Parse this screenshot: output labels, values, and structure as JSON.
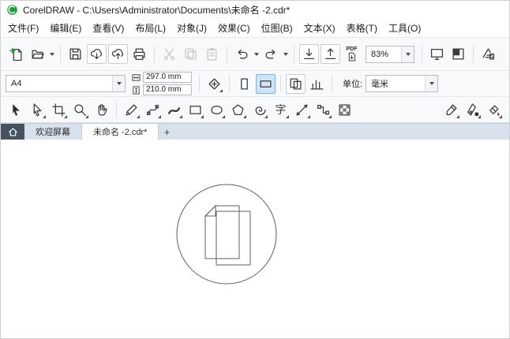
{
  "window": {
    "title": "CorelDRAW - C:\\Users\\Administrator\\Documents\\未命名 -2.cdr*"
  },
  "menu_bar": {
    "items": [
      "文件(F)",
      "编辑(E)",
      "查看(V)",
      "布局(L)",
      "对象(J)",
      "效果(C)",
      "位图(B)",
      "文本(X)",
      "表格(T)",
      "工具(O)"
    ]
  },
  "standard_toolbar": {
    "zoom_value": "83%",
    "pdf_label": "PDF",
    "icons": [
      "new-document",
      "open-document",
      "save",
      "open-from-cloud",
      "save-to-cloud",
      "print",
      "cut",
      "copy",
      "paste",
      "undo",
      "redo",
      "import",
      "export",
      "publish-pdf",
      "zoom-level",
      "fullscreen-preview",
      "view-mode",
      "app-launcher"
    ]
  },
  "property_bar": {
    "page_size_preset": "A4",
    "page_width": "297.0 mm",
    "page_height": "210.0 mm",
    "units_label": "单位:",
    "units_value": "毫米",
    "icons": [
      "page-width",
      "page-height",
      "nudge-offset",
      "portrait",
      "landscape",
      "current-page",
      "all-pages"
    ]
  },
  "toolbox": {
    "text_tool_glyph": "字",
    "tools": [
      "pick",
      "shape",
      "crop",
      "zoom",
      "pan",
      "freehand",
      "bezier",
      "artistic-media",
      "rectangle",
      "ellipse",
      "polygon",
      "spiral",
      "text",
      "dimension",
      "connector",
      "transparency",
      "eyedropper",
      "outline-pen",
      "fill"
    ]
  },
  "tab_bar": {
    "tabs": [
      "欢迎屏幕",
      "未命名 -2.cdr*"
    ],
    "new_tab_label": "+"
  },
  "canvas": {
    "objects": [
      "circle",
      "page-back",
      "page-front-folded"
    ]
  }
}
